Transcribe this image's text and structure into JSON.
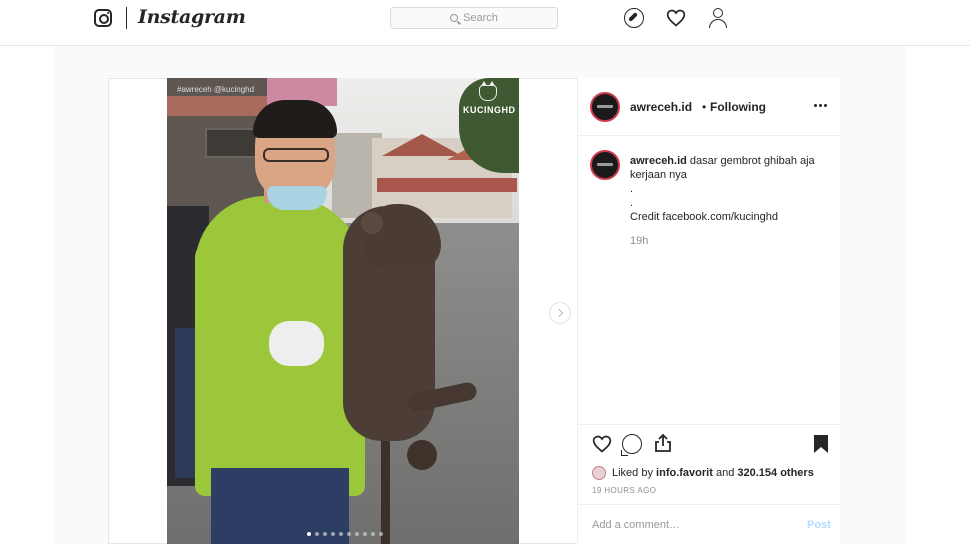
{
  "nav": {
    "wordmark": "Instagram",
    "search_placeholder": "Search",
    "icons": [
      "instagram-glyph-icon",
      "compass-icon",
      "heart-icon",
      "profile-icon"
    ]
  },
  "post": {
    "photo": {
      "watermark_left": "#awreceh @kucinghd",
      "watermark_right": "KUCINGHD",
      "carousel_count": 10,
      "carousel_active": 1
    },
    "header": {
      "username": "awreceh.id",
      "separator": "•",
      "follow_status": "Following"
    },
    "caption": {
      "username": "awreceh.id",
      "text": "dasar gembrot ghibah aja kerjaan nya",
      "line2": ".",
      "line3": ".",
      "credit": "Credit facebook.com/kucinghd",
      "time": "19h"
    },
    "likes": {
      "prefix": "Liked by",
      "by_user": "info.favorit",
      "and": "and",
      "others": "320.154 others"
    },
    "ago": "19 HOURS AGO",
    "add_comment_placeholder": "Add a comment…",
    "post_label": "Post"
  },
  "colors": {
    "avatar_ring": "#d13a4d",
    "post_button_disabled": "#b3dbff",
    "muted_text": "#8e8e8e"
  }
}
